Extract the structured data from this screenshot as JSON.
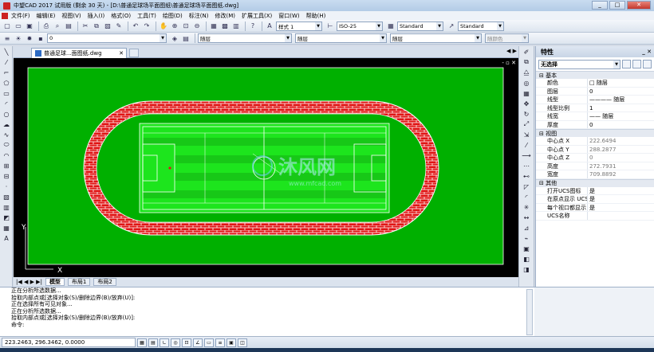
{
  "window": {
    "title": "中望CAD 2017 试用版 (剩余 30 天) - [D:\\普通足球场平面图纸\\普通足球场平面图纸.dwg]",
    "buttons": [
      "_",
      "□",
      "✕"
    ]
  },
  "menu": {
    "items": [
      "文件(F)",
      "编辑(E)",
      "视图(V)",
      "插入(I)",
      "格式(O)",
      "工具(T)",
      "绘图(D)",
      "标注(N)",
      "修改(M)",
      "扩展工具(X)",
      "窗口(W)",
      "帮助(H)"
    ]
  },
  "toolbar": {
    "text_style": "样式 1",
    "dim_style": "ISO-25",
    "table_style": "Standard",
    "multileader_style": "Standard",
    "layer": "0",
    "color": "随层",
    "linetype": "随层",
    "lineweight": "随层",
    "plot_style": "随颜色"
  },
  "document": {
    "tab_label": "普通足球...面图纸.dwg",
    "layout_tabs": [
      "模型",
      "布局1",
      "布局2"
    ]
  },
  "drawing": {
    "background": "#000000",
    "field_color": "#00b000",
    "track_color": "#e01515",
    "inner_field_color": "#1de51d",
    "watermark": "沐风网",
    "watermark_url": "www.mfcad.com"
  },
  "properties": {
    "panel_title": "特性",
    "selection": "无选择",
    "groups": [
      {
        "name": "基本",
        "rows": [
          {
            "key": "颜色",
            "value": "□ 随层"
          },
          {
            "key": "图层",
            "value": "0"
          },
          {
            "key": "线型",
            "value": "———— 随层"
          },
          {
            "key": "线型比例",
            "value": "1"
          },
          {
            "key": "线宽",
            "value": "—— 随层"
          },
          {
            "key": "厚度",
            "value": "0"
          }
        ]
      },
      {
        "name": "视图",
        "rows": [
          {
            "key": "中心点 X",
            "value": "222.6494"
          },
          {
            "key": "中心点 Y",
            "value": "288.2877"
          },
          {
            "key": "中心点 Z",
            "value": "0"
          },
          {
            "key": "高度",
            "value": "272.7931"
          },
          {
            "key": "宽度",
            "value": "709.8892"
          }
        ]
      },
      {
        "name": "其他",
        "rows": [
          {
            "key": "打开UCS图标",
            "value": "是"
          },
          {
            "key": "在原点显示 UCS ...",
            "value": "是"
          },
          {
            "key": "每个视口都显示 ...",
            "value": "是"
          },
          {
            "key": "UCS名称",
            "value": ""
          }
        ]
      }
    ]
  },
  "command_history": [
    "正在分析所选数据...",
    "拾取内部点或[选择对象(S)/删除边界(B)/放弃(U)]:",
    "正在选择所有可见对象...",
    "正在分析所选数据...",
    "拾取内部点或[选择对象(S)/删除边界(B)/放弃(U)]:",
    "命令:"
  ],
  "status": {
    "coordinates": "223.2463, 296.3462, 0.0000"
  }
}
